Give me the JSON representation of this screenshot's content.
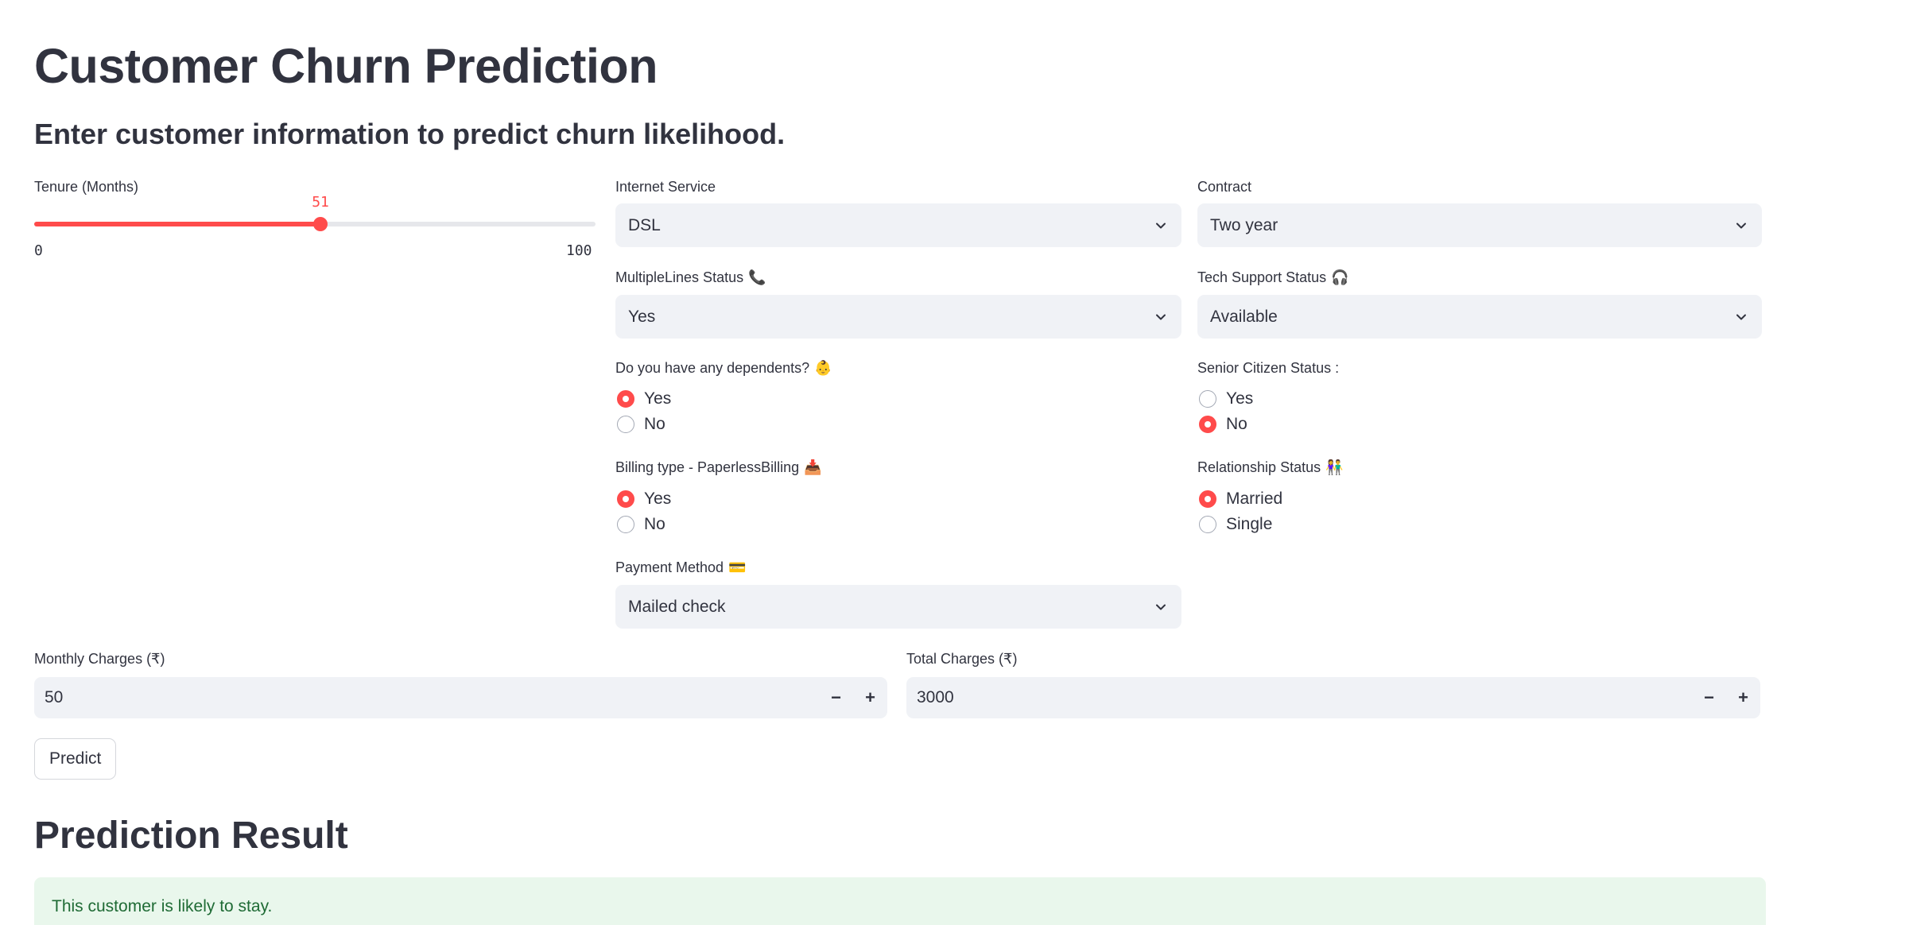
{
  "header": {
    "title": "Customer Churn Prediction",
    "subtitle": "Enter customer information to predict churn likelihood."
  },
  "tenure": {
    "label": "Tenure (Months)",
    "value": 51,
    "value_text": "51",
    "min": 0,
    "max": 100,
    "min_text": "0",
    "max_text": "100"
  },
  "internet_service": {
    "label": "Internet Service",
    "value": "DSL"
  },
  "contract": {
    "label": "Contract",
    "value": "Two year"
  },
  "multiple_lines": {
    "label": "MultipleLines Status",
    "emoji": "📞",
    "value": "Yes"
  },
  "tech_support": {
    "label": "Tech Support Status",
    "emoji": "🎧",
    "value": "Available"
  },
  "dependents": {
    "label": "Do you have any dependents?",
    "emoji": "👶",
    "options": [
      "Yes",
      "No"
    ],
    "selected": "Yes"
  },
  "senior_citizen": {
    "label": "Senior Citizen Status :",
    "options": [
      "Yes",
      "No"
    ],
    "selected": "No"
  },
  "paperless_billing": {
    "label": "Billing type - PaperlessBilling",
    "emoji": "📥",
    "options": [
      "Yes",
      "No"
    ],
    "selected": "Yes"
  },
  "relationship": {
    "label": "Relationship Status",
    "emoji": "👫",
    "options": [
      "Married",
      "Single"
    ],
    "selected": "Married"
  },
  "payment_method": {
    "label": "Payment Method",
    "emoji": "💳",
    "value": "Mailed check"
  },
  "monthly_charges": {
    "label": "Monthly Charges (₹)",
    "value": "50",
    "minus": "−",
    "plus": "+"
  },
  "total_charges": {
    "label": "Total Charges (₹)",
    "value": "3000",
    "minus": "−",
    "plus": "+"
  },
  "predict_button": {
    "label": "Predict"
  },
  "result": {
    "heading": "Prediction Result",
    "message": "This customer is likely to stay."
  },
  "colors": {
    "accent": "#ff4b4b",
    "text": "#31333f",
    "input_bg": "#f0f2f6",
    "success_bg": "#e9f7ec",
    "success_text": "#1f6b35"
  }
}
